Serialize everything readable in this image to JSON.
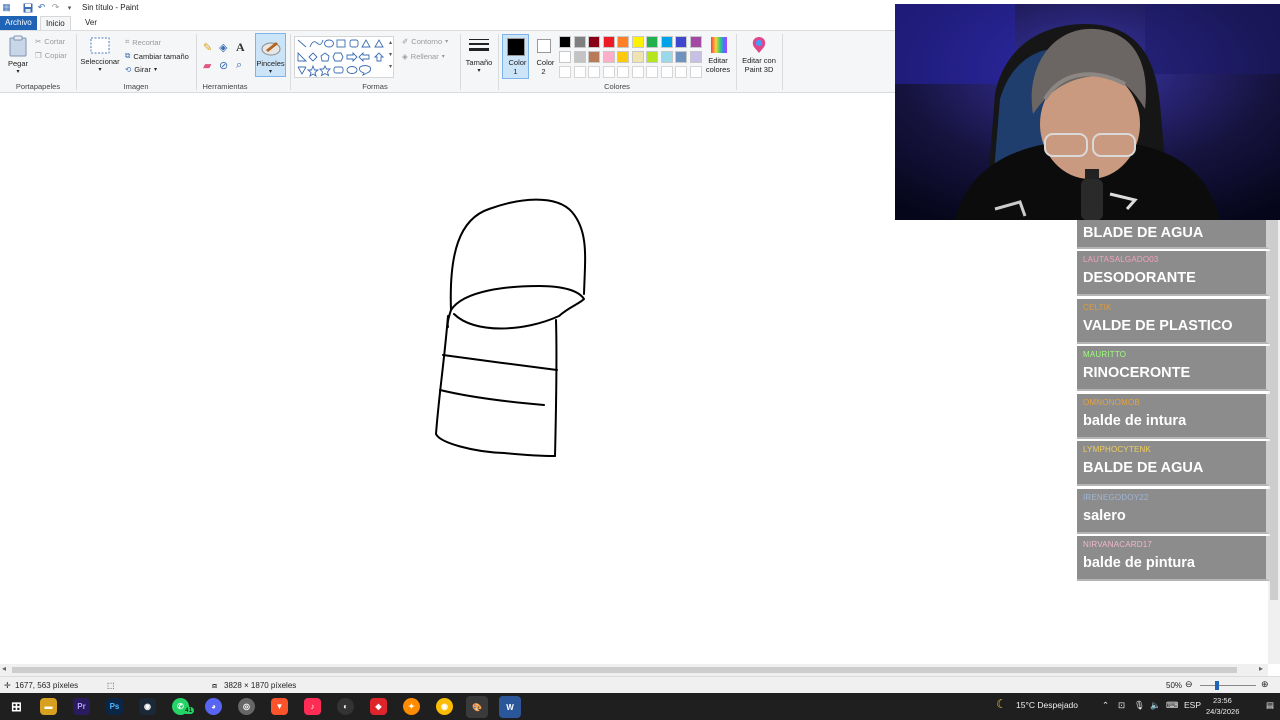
{
  "window": {
    "title": "Sin título - Paint"
  },
  "menu_tabs": {
    "file": "Archivo",
    "home": "Inicio",
    "view": "Ver"
  },
  "ribbon": {
    "clipboard": {
      "paste": "Pegar",
      "cut": "Cortar",
      "copy": "Copiar",
      "label": "Portapapeles"
    },
    "image": {
      "select": "Seleccionar",
      "crop": "Recortar",
      "resize": "Cambiar tamaño",
      "rotate": "Girar",
      "label": "Imagen"
    },
    "tools": {
      "label": "Herramientas",
      "brushes": "Pinceles"
    },
    "shapes": {
      "outline": "Contorno",
      "fill": "Rellenar",
      "label": "Formas"
    },
    "size": {
      "label": "Tamaño"
    },
    "colors": {
      "color1": "Color 1",
      "color2": "Color 2",
      "edit": "Editar colores",
      "paint3d": "Editar con Paint 3D",
      "label": "Colores",
      "color1_value": "#000000",
      "color2_value": "#ffffff",
      "palette_row1": [
        "#000000",
        "#7f7f7f",
        "#880015",
        "#ed1c24",
        "#ff7f27",
        "#fff200",
        "#22b14c",
        "#00a2e8",
        "#3f48cc",
        "#a349a4"
      ],
      "palette_row2": [
        "#ffffff",
        "#c3c3c3",
        "#b97a57",
        "#ffaec9",
        "#ffc90e",
        "#efe4b0",
        "#b5e61d",
        "#99d9ea",
        "#7092be",
        "#c8bfe7"
      ]
    }
  },
  "statusbar": {
    "cursor": "1677, 563 píxeles",
    "canvas_size": "3828 × 1870 píxeles",
    "zoom": "50%",
    "zoom_fraction": 0.5
  },
  "taskbar": {
    "weather": "15°C  Despejado",
    "lang": "ESP",
    "time": "23:56",
    "date": "24/3/2026",
    "whatsapp_badge": "41"
  },
  "chat": [
    {
      "user": "",
      "message": "BLADE DE AGUA",
      "user_color": "#cccccc"
    },
    {
      "user": "LAUTASALGADO03",
      "message": "DESODORANTE",
      "user_color": "#f2a2c0"
    },
    {
      "user": "CELTIK",
      "message": "VALDE DE PLASTICO",
      "user_color": "#e09c2f"
    },
    {
      "user": "MAURITTO",
      "message": "RINOCERONTE",
      "user_color": "#9cff7a"
    },
    {
      "user": "OMNONOMOB",
      "message": "balde de intura",
      "user_color": "#e8a23a"
    },
    {
      "user": "LYMPHOCYTENK",
      "message": "BALDE DE AGUA",
      "user_color": "#f2cf5b"
    },
    {
      "user": "IRENEGODOY22",
      "message": "salero",
      "user_color": "#9fb6d8"
    },
    {
      "user": "NIRVANACARD17",
      "message": "balde de pintura",
      "user_color": "#f0b8cc"
    }
  ]
}
